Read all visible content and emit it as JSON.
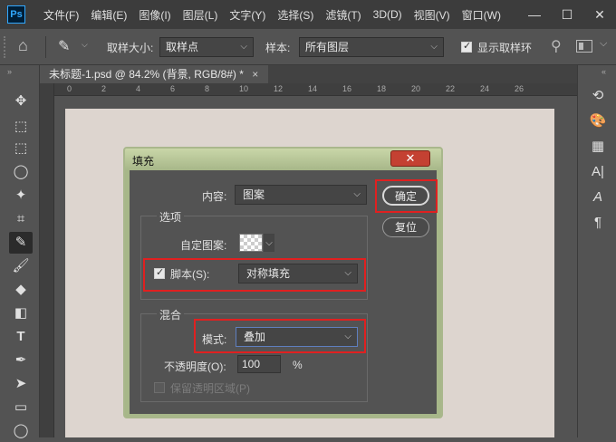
{
  "app_logo": "Ps",
  "menu": [
    "文件(F)",
    "编辑(E)",
    "图像(I)",
    "图层(L)",
    "文字(Y)",
    "选择(S)",
    "滤镜(T)",
    "3D(D)",
    "视图(V)",
    "窗口(W)"
  ],
  "window_controls": {
    "minimize": "—",
    "maximize": "☐",
    "close": "✕"
  },
  "options": {
    "home_icon": "⌂",
    "eyedropper_icon": "✎",
    "sample_size_label": "取样大小:",
    "sample_size_value": "取样点",
    "sample_label": "样本:",
    "sample_value": "所有图层",
    "show_ring_label": "显示取样环",
    "show_ring_checked": true
  },
  "document_tab": {
    "title": "未标题-1.psd @ 84.2% (背景, RGB/8#) *",
    "close": "×"
  },
  "ruler_ticks": [
    "0",
    "2",
    "4",
    "6",
    "8",
    "10",
    "12",
    "14",
    "16",
    "18",
    "20",
    "22",
    "24",
    "26"
  ],
  "colors": {
    "accent_red": "#e02020",
    "dialog_frame": "#a7b789",
    "canvas": "#ddd5cf"
  },
  "dialog": {
    "title": "填充",
    "close_symbol": "✕",
    "content_label": "内容:",
    "content_value": "图案",
    "ok_button": "确定",
    "reset_button": "复位",
    "options_group": "选项",
    "custom_pattern_label": "自定图案:",
    "script_label": "脚本(S):",
    "script_checked": true,
    "script_value": "对称填充",
    "blend_group": "混合",
    "mode_label": "模式:",
    "mode_value": "叠加",
    "opacity_label": "不透明度(O):",
    "opacity_value": "100",
    "opacity_unit": "%",
    "preserve_label": "保留透明区域(P)",
    "preserve_checked": false
  }
}
